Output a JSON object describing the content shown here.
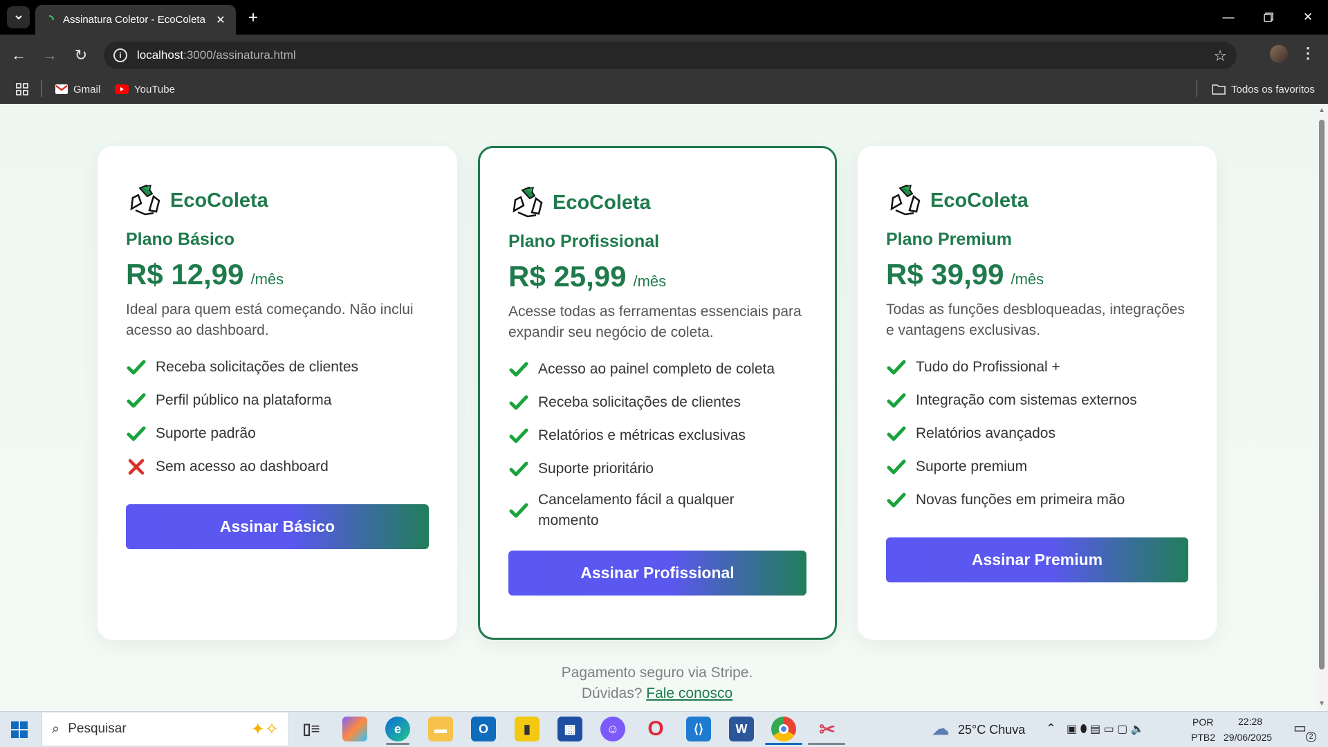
{
  "browser": {
    "tab_title": "Assinatura Coletor - EcoColeta",
    "url_host": "localhost",
    "url_rest": ":3000/assinatura.html",
    "bookmarks": [
      {
        "label": "Gmail",
        "icon": "gmail-icon"
      },
      {
        "label": "YouTube",
        "icon": "youtube-icon"
      }
    ],
    "all_bookmarks": "Todos os favoritos"
  },
  "brand": {
    "name": "EcoColeta",
    "color": "#1f7a4c",
    "accent": "#5b57f2"
  },
  "plans": [
    {
      "name": "Plano Básico",
      "price": "R$ 12,99",
      "period": "/mês",
      "description": "Ideal para quem está começando. Não inclui acesso ao dashboard.",
      "features": [
        {
          "text": "Receba solicitações de clientes",
          "included": true
        },
        {
          "text": "Perfil público na plataforma",
          "included": true
        },
        {
          "text": "Suporte padrão",
          "included": true
        },
        {
          "text": "Sem acesso ao dashboard",
          "included": false
        }
      ],
      "cta": "Assinar Básico"
    },
    {
      "name": "Plano Profissional",
      "price": "R$ 25,99",
      "period": "/mês",
      "description": "Acesse todas as ferramentas essenciais para expandir seu negócio de coleta.",
      "features": [
        {
          "text": "Acesso ao painel completo de coleta",
          "included": true
        },
        {
          "text": "Receba solicitações de clientes",
          "included": true
        },
        {
          "text": "Relatórios e métricas exclusivas",
          "included": true
        },
        {
          "text": "Suporte prioritário",
          "included": true
        },
        {
          "text": "Cancelamento fácil a qualquer momento",
          "included": true
        }
      ],
      "cta": "Assinar Profissional"
    },
    {
      "name": "Plano Premium",
      "price": "R$ 39,99",
      "period": "/mês",
      "description": "Todas as funções desbloqueadas, integrações e vantagens exclusivas.",
      "features": [
        {
          "text": "Tudo do Profissional +",
          "included": true
        },
        {
          "text": "Integração com sistemas externos",
          "included": true
        },
        {
          "text": "Relatórios avançados",
          "included": true
        },
        {
          "text": "Suporte premium",
          "included": true
        },
        {
          "text": "Novas funções em primeira mão",
          "included": true
        }
      ],
      "cta": "Assinar Premium"
    }
  ],
  "footer": {
    "secure": "Pagamento seguro via Stripe.",
    "question": "Dúvidas?",
    "contact_link": "Fale conosco"
  },
  "taskbar": {
    "search_placeholder": "Pesquisar",
    "weather": "25°C  Chuva",
    "lang": "POR",
    "layout": "PTB2",
    "time": "22:28",
    "date": "29/06/2025",
    "notifications": "2"
  }
}
